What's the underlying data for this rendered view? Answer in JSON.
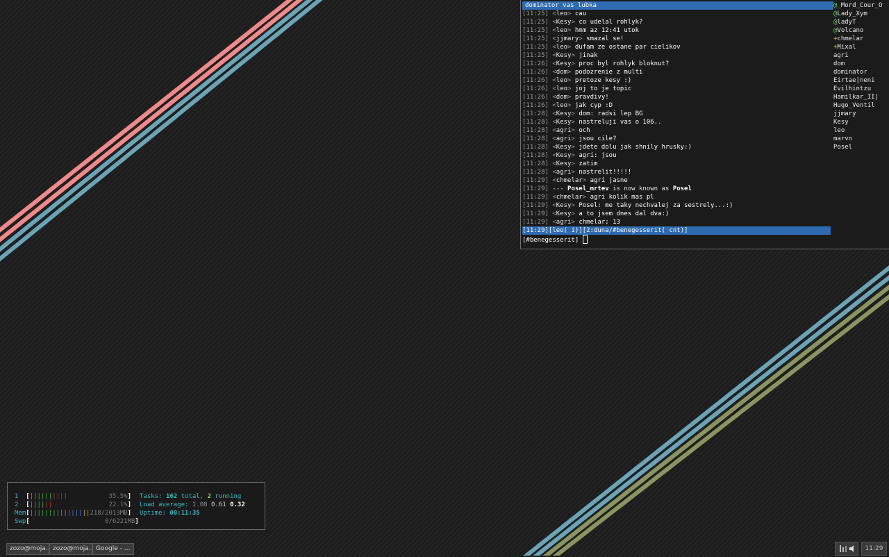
{
  "colors": {
    "stripe_pink": "#f08a8a",
    "stripe_blue": "#6aa4b6",
    "stripe_olive": "#8a9460",
    "irc_bar": "#2e6bb0"
  },
  "irc": {
    "topic": "dominator vas lubka",
    "messages": [
      {
        "ts": "11:25",
        "nick": "leo",
        "text": "cau"
      },
      {
        "ts": "11:25",
        "nick": "Kesy",
        "text": "co udelal rohlyk?"
      },
      {
        "ts": "11:25",
        "nick": "leo",
        "text": "hmm az 12:41 utok"
      },
      {
        "ts": "11:25",
        "nick": "jjmary",
        "text": "smazal se!"
      },
      {
        "ts": "11:25",
        "nick": "leo",
        "text": "dufam ze ostane par cielikov"
      },
      {
        "ts": "11:25",
        "nick": "Kesy",
        "text": "jinak"
      },
      {
        "ts": "11:26",
        "nick": "Kesy",
        "text": "proc byl rohlyk bloknut?"
      },
      {
        "ts": "11:26",
        "nick": "dom",
        "text": "podozrenie z multi"
      },
      {
        "ts": "11:26",
        "nick": "leo",
        "text": "pretoze kesy :)"
      },
      {
        "ts": "11:26",
        "nick": "leo",
        "text": "joj to je topic"
      },
      {
        "ts": "11:26",
        "nick": "dom",
        "text": "pravdivy!"
      },
      {
        "ts": "11:26",
        "nick": "leo",
        "text": "jak cyp :D"
      },
      {
        "ts": "11:28",
        "nick": "Kesy",
        "text": "dom: radsi lep BG"
      },
      {
        "ts": "11:28",
        "nick": "Kesy",
        "text": "nastreluji vas o 106.."
      },
      {
        "ts": "11:28",
        "nick": "agri",
        "text": "och"
      },
      {
        "ts": "11:28",
        "nick": "agri",
        "text": "jsou cile?"
      },
      {
        "ts": "11:28",
        "nick": "Kesy",
        "text": "jdete dolu jak shnily hrusky:)"
      },
      {
        "ts": "11:28",
        "nick": "Kesy",
        "text": "agri: jsou"
      },
      {
        "ts": "11:28",
        "nick": "Kesy",
        "text": "zatim"
      },
      {
        "ts": "11:28",
        "nick": "agri",
        "text": "nastrelit!!!!!"
      },
      {
        "ts": "11:29",
        "nick": "chmelar",
        "text": "agri jasne"
      },
      {
        "ts": "11:29",
        "nick": "",
        "system": true,
        "prefix": "---",
        "old": "Posel_mrtev",
        "mid": "is now known as",
        "new": "Posel"
      },
      {
        "ts": "11:29",
        "nick": "chmelar",
        "text": "agri kolik mas pl"
      },
      {
        "ts": "11:29",
        "nick": "Kesy",
        "text": "Posel: me taky nechvalej za sestrely...:)"
      },
      {
        "ts": "11:29",
        "nick": "Kesy",
        "text": "a to jsem dnes dal dva:)"
      },
      {
        "ts": "11:29",
        "nick": "agri",
        "text": "chmelar; 13"
      }
    ],
    "status": "[11:29][leo( i)][2:duna/#benegesserit( cnt)]",
    "prompt": "[#benegesserit] ",
    "users": [
      {
        "mode": "@",
        "name": "_Mord_Cour_O"
      },
      {
        "mode": "@",
        "name": "Lady_Xym"
      },
      {
        "mode": "@",
        "name": "ladyT"
      },
      {
        "mode": "@",
        "name": "Volcano"
      },
      {
        "mode": "+",
        "name": "chmelar"
      },
      {
        "mode": "+",
        "name": "Mixal"
      },
      {
        "mode": "",
        "name": "agri"
      },
      {
        "mode": "",
        "name": "dom"
      },
      {
        "mode": "",
        "name": "dominator"
      },
      {
        "mode": "",
        "name": "Eirtae|neni"
      },
      {
        "mode": "",
        "name": "Evilhintzu"
      },
      {
        "mode": "",
        "name": "Hamilkar_II|"
      },
      {
        "mode": "",
        "name": "Hugo_Ventil"
      },
      {
        "mode": "",
        "name": "jjmary"
      },
      {
        "mode": "",
        "name": "Kesy"
      },
      {
        "mode": "",
        "name": "leo"
      },
      {
        "mode": "",
        "name": "marvn"
      },
      {
        "mode": "",
        "name": "Posel"
      }
    ]
  },
  "htop": {
    "cpu1": {
      "label": "1",
      "bars_g": "||||||",
      "bars_r": "||||",
      "value": "35.5%"
    },
    "cpu2": {
      "label": "2",
      "bars_g": "||||",
      "bars_r": "||",
      "value": "22.1%"
    },
    "mem": {
      "label": "Mem",
      "bars_g": "||||||||||",
      "bars_b": "||||",
      "bars_y": "||",
      "value": "218/2013MB"
    },
    "swp": {
      "label": "Swp",
      "value": "0/6221MB"
    },
    "tasks_label": "Tasks:",
    "tasks_total": "162",
    "tasks_total_suffix": "total,",
    "tasks_running": "2",
    "tasks_running_suffix": "running",
    "load_label": "Load average:",
    "load1": "1.08",
    "load5": "0.61",
    "load15": "0.32",
    "uptime_label": "Uptime:",
    "uptime": "00:11:35"
  },
  "taskbar": {
    "tasks": [
      "zozo@moja…",
      "zozo@moja…",
      "Google - …"
    ],
    "clock": "11:29"
  }
}
